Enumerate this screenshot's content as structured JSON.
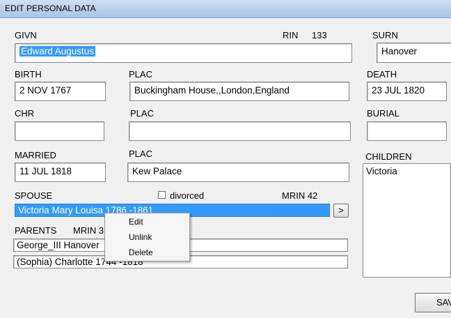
{
  "window": {
    "title": "EDIT PERSONAL DATA"
  },
  "givn": {
    "label": "GIVN",
    "value": "Edward Augustus"
  },
  "rin": {
    "label": "RIN",
    "value": "133"
  },
  "surn": {
    "label": "SURN",
    "value": "Hanover"
  },
  "birth": {
    "label": "BIRTH",
    "date": "2 NOV 1767",
    "plac_label": "PLAC",
    "plac": "Buckingham House,,London,England"
  },
  "death": {
    "label": "DEATH",
    "date": "23 JUL 1820"
  },
  "chr": {
    "label": "CHR",
    "date": "",
    "plac_label": "PLAC",
    "plac": ""
  },
  "burial": {
    "label": "BURIAL",
    "date": ""
  },
  "married": {
    "label": "MARRIED",
    "date": "11 JUL 1818",
    "plac_label": "PLAC",
    "plac": "Kew Palace"
  },
  "children": {
    "label": "CHILDREN",
    "items": [
      "Victoria"
    ]
  },
  "spouse": {
    "label": "SPOUSE",
    "divorced_label": "divorced",
    "divorced_checked": false,
    "mrin_label": "MRIN 42",
    "value": "Victoria Mary Louisa  1786 -1861",
    "arrow": ">"
  },
  "parents": {
    "label": "PARENTS",
    "mrin_label": "MRIN  3",
    "father": "George_III  Hanover",
    "mother": "(Sophia) Charlotte   1744 -1818"
  },
  "context_menu": {
    "items": [
      "Edit",
      "Unlink",
      "Delete"
    ]
  },
  "save_button": {
    "label": "SAV"
  },
  "colors": {
    "selection": "#3399ff",
    "titlebar": "#b7cfea",
    "background": "#f0f0f0"
  }
}
